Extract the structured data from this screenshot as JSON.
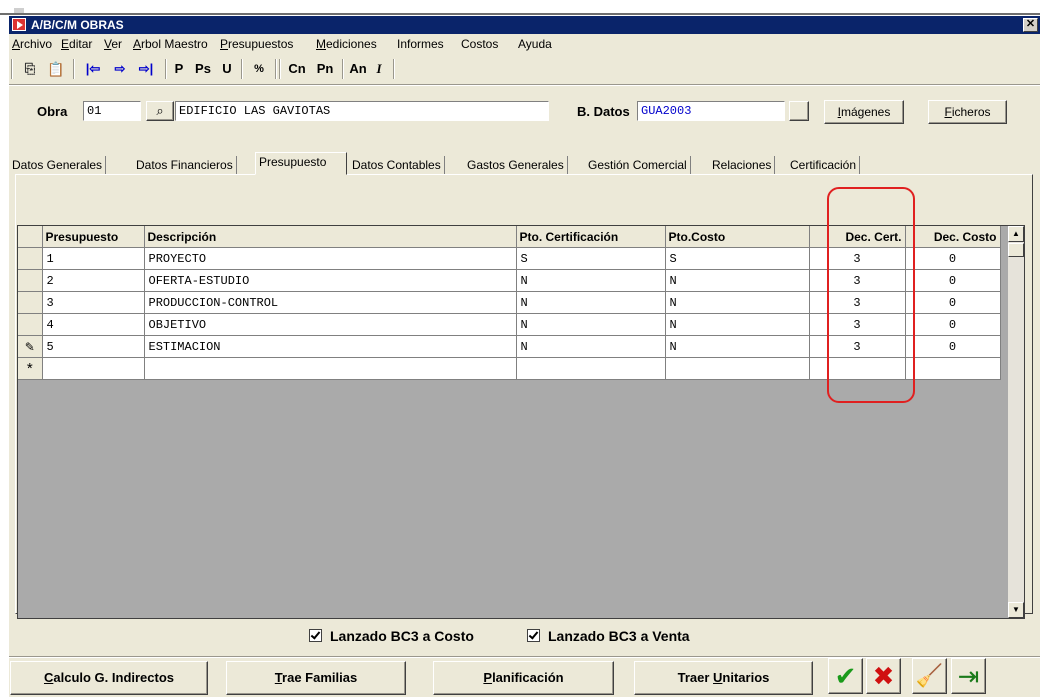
{
  "window": {
    "title": "A/B/C/M OBRAS",
    "close": "✕"
  },
  "menu": [
    {
      "pre": "",
      "u": "A",
      "post": "rchivo"
    },
    {
      "pre": "",
      "u": "E",
      "post": "ditar"
    },
    {
      "pre": "",
      "u": "V",
      "post": "er"
    },
    {
      "pre": "",
      "u": "A",
      "post": "rbol Maestro"
    },
    {
      "pre": "",
      "u": "P",
      "post": "resupuestos"
    },
    {
      "pre": "",
      "u": "M",
      "post": "ediciones"
    },
    {
      "pre": "",
      "u": "",
      "post": "Informes"
    },
    {
      "pre": "",
      "u": "",
      "post": "Costos"
    },
    {
      "pre": "",
      "u": "",
      "post": "Ayuda"
    }
  ],
  "toolbar": {
    "copy": "⎘",
    "paste": "📋",
    "first": "|⇦",
    "next": "⇨",
    "last": "⇨|",
    "p": "P",
    "ps": "Ps",
    "u": "U",
    "pct": "%",
    "cn": "Cn",
    "pn": "Pn",
    "an": "An",
    "i": "I"
  },
  "header": {
    "obra_label": "Obra",
    "obra_code": "01",
    "obra_name": "EDIFICIO LAS GAVIOTAS",
    "bdatos_label": "B. Datos",
    "bdatos_value": "GUA2003",
    "imagenes": {
      "u": "I",
      "post": "mágenes"
    },
    "ficheros": {
      "u": "F",
      "post": "icheros"
    }
  },
  "tabs": [
    "Datos Generales",
    "Datos Financieros",
    "Presupuesto",
    "Datos Contables",
    "Gastos Generales",
    "Gestión Comercial",
    "Relaciones",
    "Certificación"
  ],
  "active_tab": "Presupuesto",
  "grid": {
    "columns": [
      "Presupuesto",
      "Descripción",
      "Pto. Certificación",
      "Pto.Costo",
      "Dec. Cert.",
      "Dec. Costo"
    ],
    "rows": [
      {
        "presupuesto": "1",
        "descripcion": "PROYECTO",
        "pto_cert": "S",
        "pto_costo": "S",
        "dec_cert": "3",
        "dec_costo": "0"
      },
      {
        "presupuesto": "2",
        "descripcion": "OFERTA-ESTUDIO",
        "pto_cert": "N",
        "pto_costo": "N",
        "dec_cert": "3",
        "dec_costo": "0"
      },
      {
        "presupuesto": "3",
        "descripcion": "PRODUCCION-CONTROL",
        "pto_cert": "N",
        "pto_costo": "N",
        "dec_cert": "3",
        "dec_costo": "0"
      },
      {
        "presupuesto": "4",
        "descripcion": "OBJETIVO",
        "pto_cert": "N",
        "pto_costo": "N",
        "dec_cert": "3",
        "dec_costo": "0"
      },
      {
        "presupuesto": "5",
        "descripcion": "ESTIMACION",
        "pto_cert": "N",
        "pto_costo": "N",
        "dec_cert": "3",
        "dec_costo": "0"
      }
    ],
    "edit_marker": "✎",
    "new_marker": "*"
  },
  "checks": {
    "costo": "Lanzado BC3 a Costo",
    "venta": "Lanzado BC3 a Venta"
  },
  "buttons": {
    "calculo": {
      "u": "C",
      "post": "alculo G. Indirectos"
    },
    "trae": {
      "u": "T",
      "post": "rae Familias"
    },
    "planif": {
      "u": "P",
      "post": "lanificación"
    },
    "traer_pre": "Traer ",
    "traer_u": "U",
    "traer_post": "nitarios",
    "accept": "✔",
    "cancel": "✖",
    "clean": "🧹",
    "exit": "⇥"
  },
  "colors": {
    "title_bg": "#0a246a",
    "window_bg": "#ece9d8",
    "highlight": "#e02020",
    "blue_text": "#0000cc",
    "accept": "#1a9a1a",
    "cancel": "#d01010"
  }
}
